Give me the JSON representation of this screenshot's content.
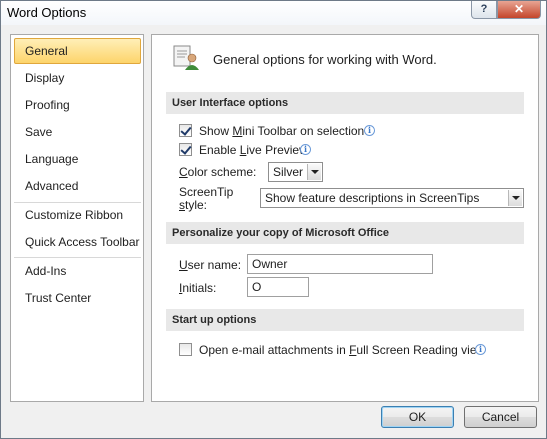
{
  "window": {
    "title": "Word Options",
    "help_glyph": "?",
    "close_glyph": "✕"
  },
  "sidebar": {
    "items": [
      {
        "label": "General",
        "active": true
      },
      {
        "label": "Display"
      },
      {
        "label": "Proofing"
      },
      {
        "label": "Save"
      },
      {
        "label": "Language"
      },
      {
        "label": "Advanced"
      },
      {
        "label": "Customize Ribbon"
      },
      {
        "label": "Quick Access Toolbar"
      },
      {
        "label": "Add-Ins"
      },
      {
        "label": "Trust Center"
      }
    ]
  },
  "main": {
    "header": "General options for working with Word.",
    "header_icon": "general-options-icon",
    "ui_section": {
      "title": "User Interface options",
      "mini_toolbar": {
        "pre": "Show ",
        "key": "M",
        "post": "ini Toolbar on selection",
        "checked": true
      },
      "live_preview": {
        "pre": "Enable ",
        "key": "L",
        "post": "ive Preview",
        "checked": true
      },
      "color_scheme": {
        "pre": "",
        "key": "C",
        "post": "olor scheme:",
        "value": "Silver"
      },
      "screentip": {
        "label_line1": "ScreenTip",
        "label_line2_key": "s",
        "label_line2_post": "tyle:",
        "value": "Show feature descriptions in ScreenTips"
      }
    },
    "personalize_section": {
      "title": "Personalize your copy of Microsoft Office",
      "username": {
        "key": "U",
        "post": "ser name:",
        "value": "Owner"
      },
      "initials": {
        "key": "I",
        "post": "nitials:",
        "value": "O"
      }
    },
    "startup_section": {
      "title": "Start up options",
      "email_attach": {
        "pre": "Open e-mail attachments in ",
        "key": "F",
        "post": "ull Screen Reading view",
        "checked": false
      }
    }
  },
  "footer": {
    "ok_label": "OK",
    "cancel_label": "Cancel"
  },
  "colors": {
    "active_nav": "#fdd46b",
    "section_bar": "#e8e8e8",
    "info_icon": "#3a78c9"
  }
}
